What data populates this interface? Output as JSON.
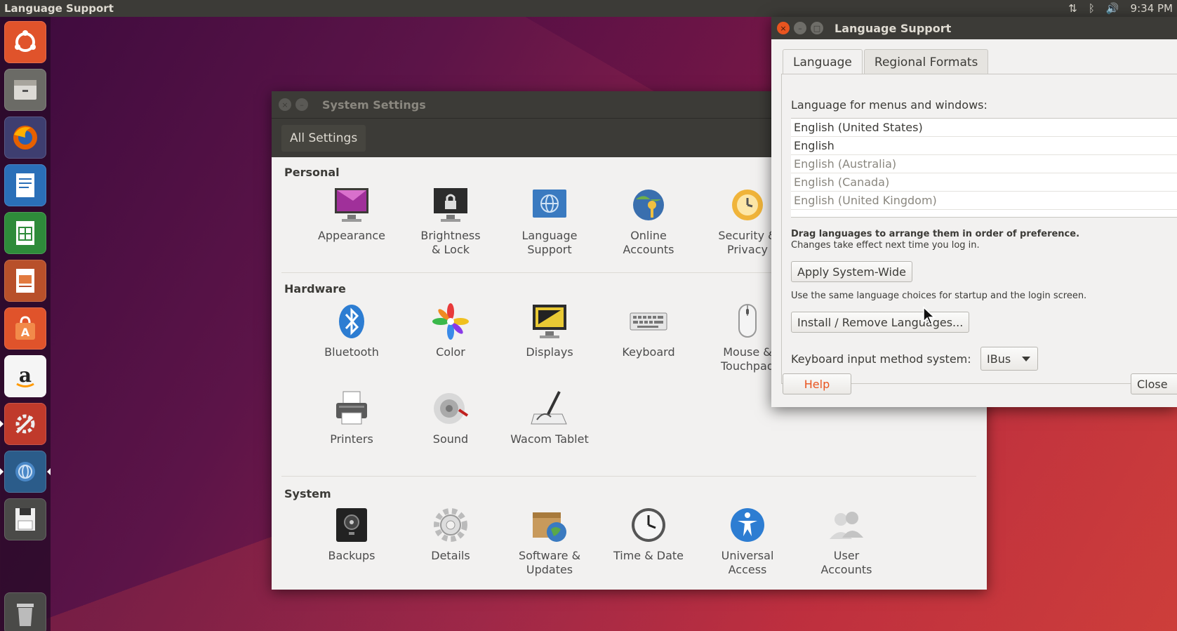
{
  "top_panel": {
    "app_title": "Language Support",
    "tray": {
      "network_icon": "⇅",
      "bluetooth_icon": "ᛒ",
      "volume_icon": "🔊",
      "time": "9:34 PM"
    }
  },
  "launcher": {
    "items": [
      "ubuntu-dash",
      "files",
      "firefox",
      "libreoffice-writer",
      "libreoffice-calc",
      "libreoffice-impress",
      "ubuntu-software",
      "amazon",
      "system-settings",
      "language-support",
      "floppy-drive",
      "trash"
    ]
  },
  "system_settings": {
    "title": "System Settings",
    "all_settings": "All Settings",
    "sections": {
      "personal": {
        "label": "Personal",
        "items": [
          "Appearance",
          "Brightness & Lock",
          "Language Support",
          "Online Accounts",
          "Security & Privacy"
        ]
      },
      "hardware": {
        "label": "Hardware",
        "items": [
          "Bluetooth",
          "Color",
          "Displays",
          "Keyboard",
          "Mouse & Touchpad",
          "Printers",
          "Sound",
          "Wacom Tablet"
        ]
      },
      "system": {
        "label": "System",
        "items": [
          "Backups",
          "Details",
          "Software & Updates",
          "Time & Date",
          "Universal Access",
          "User Accounts"
        ]
      }
    }
  },
  "language_support": {
    "title": "Language Support",
    "tabs": [
      "Language",
      "Regional Formats"
    ],
    "active_tab": "Language",
    "menus_label": "Language for menus and windows:",
    "languages": [
      "English (United States)",
      "English",
      "English (Australia)",
      "English (Canada)",
      "English (United Kingdom)"
    ],
    "drag_hint": "Drag languages to arrange them in order of preference.",
    "changes_hint": "Changes take effect next time you log in.",
    "apply_button": "Apply System-Wide",
    "apply_desc": "Use the same language choices for startup and the login screen.",
    "install_button": "Install / Remove Languages...",
    "keyboard_label": "Keyboard input method system:",
    "keyboard_value": "IBus",
    "help_button": "Help",
    "close_button": "Close"
  },
  "colors": {
    "panel": "#3c3b37",
    "window_bg": "#f2f1f0",
    "accent_orange": "#e9541f",
    "text": "#3c3b37"
  }
}
